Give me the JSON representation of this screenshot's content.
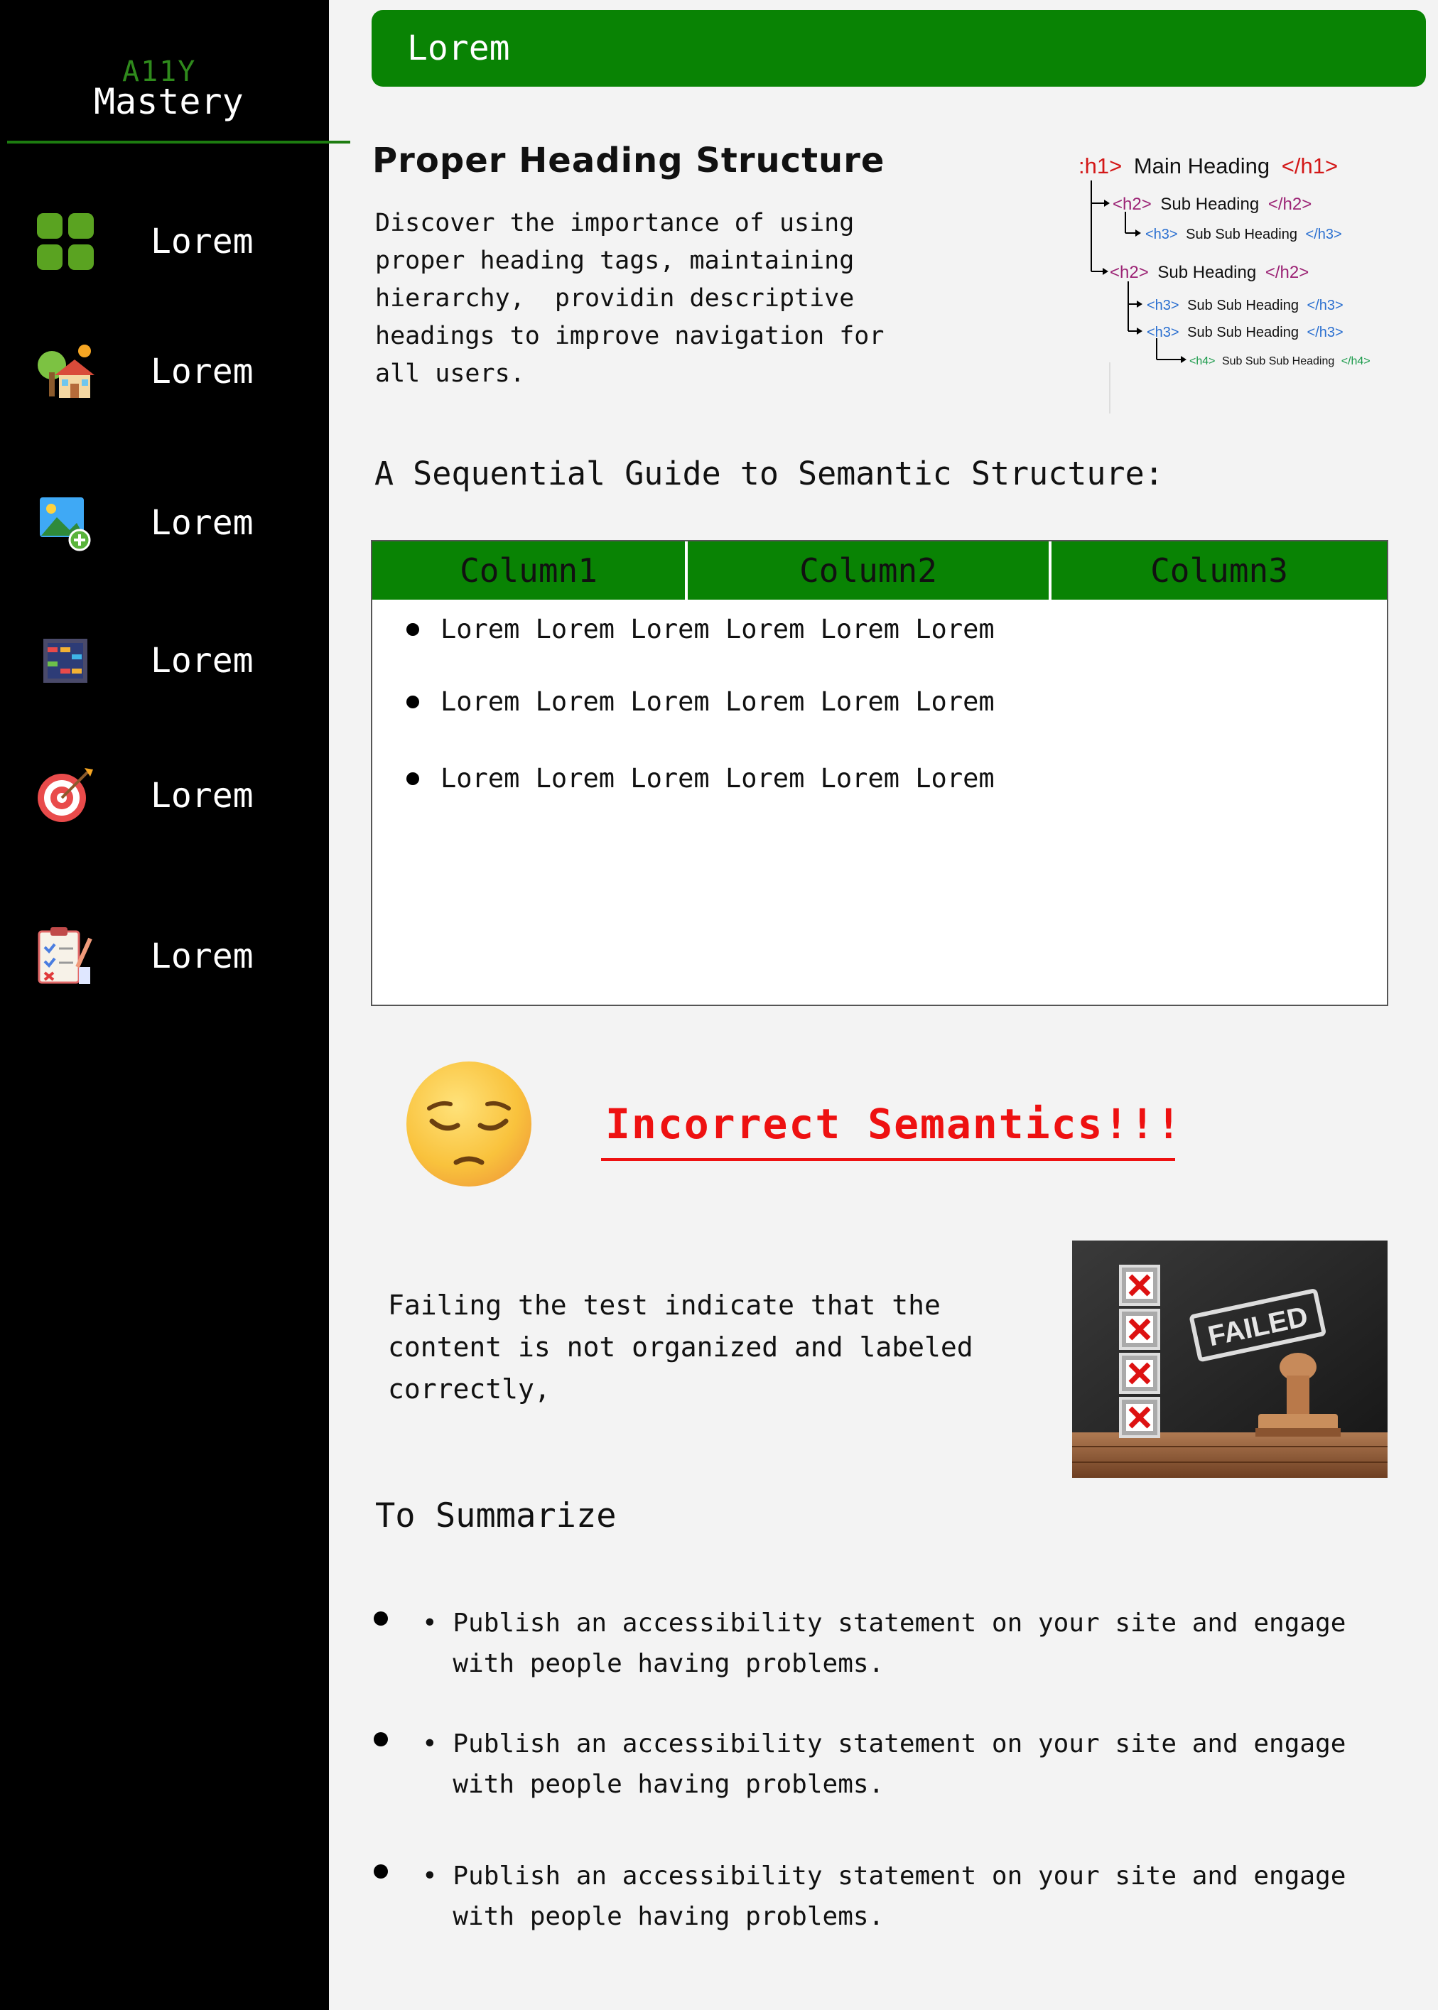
{
  "sidebar": {
    "brand_top": "A11Y",
    "brand_bottom": "Mastery",
    "items": [
      {
        "label": "Lorem",
        "icon": "grid-icon"
      },
      {
        "label": "Lorem",
        "icon": "house-icon"
      },
      {
        "label": "Lorem",
        "icon": "add-image-icon"
      },
      {
        "label": "Lorem",
        "icon": "abacus-icon"
      },
      {
        "label": "Lorem",
        "icon": "target-icon"
      },
      {
        "label": "Lorem",
        "icon": "checklist-icon"
      }
    ]
  },
  "header": {
    "title": "Lorem"
  },
  "section": {
    "title": "Proper Heading Structure",
    "description": "Discover the importance of using\nproper heading tags, maintaining\nhierarchy,  providin descriptive\nheadings to improve navigation for\nall users."
  },
  "diagram": {
    "h1": {
      "open": ":h1>",
      "text": "Main Heading",
      "close": "</h1>"
    },
    "h2a": {
      "open": "<h2>",
      "text": "Sub Heading",
      "close": "</h2>"
    },
    "h3a": {
      "open": "<h3>",
      "text": "Sub Sub Heading",
      "close": "</h3>"
    },
    "h2b": {
      "open": "<h2>",
      "text": "Sub Heading",
      "close": "</h2>"
    },
    "h3b": {
      "open": "<h3>",
      "text": "Sub Sub Heading",
      "close": "</h3>"
    },
    "h3c": {
      "open": "<h3>",
      "text": "Sub Sub Heading",
      "close": "</h3>"
    },
    "h4": {
      "open": "<h4>",
      "text": "Sub Sub Sub Heading",
      "close": "</h4>"
    }
  },
  "guide": {
    "title": "A Sequential Guide to Semantic Structure:"
  },
  "table": {
    "columns": [
      "Column1",
      "Column2",
      "Column3"
    ],
    "rows": [
      "Lorem Lorem Lorem Lorem Lorem Lorem",
      "Lorem Lorem Lorem Lorem Lorem Lorem",
      "Lorem Lorem Lorem Lorem Lorem Lorem"
    ]
  },
  "incorrect": {
    "title": "Incorrect Semantics!!!"
  },
  "fail": {
    "text": "Failing the test indicate that the content is not organized and labeled correctly,",
    "stamp": "FAILED"
  },
  "summary": {
    "title": "To Summarize",
    "items": [
      "• Publish an accessibility statement on your site and engage\n  with people having problems.",
      "• Publish an accessibility statement on your site and engage\n  with people having problems.",
      "• Publish an accessibility statement on your site and engage\n  with people having problems."
    ]
  },
  "colors": {
    "accent": "#098304",
    "error": "#ee1111",
    "sidebar": "#000000"
  }
}
